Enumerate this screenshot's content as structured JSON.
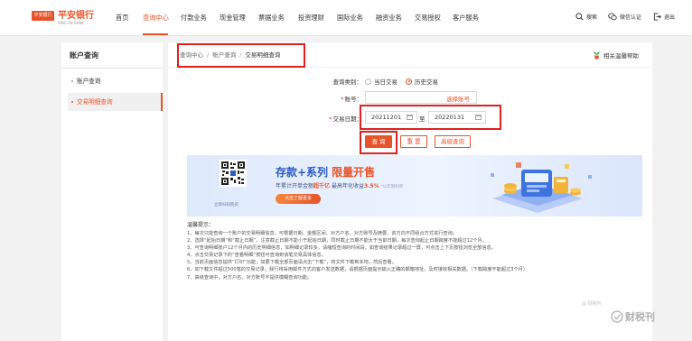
{
  "brand": {
    "badge": "平安银行",
    "name": "平安银行",
    "sub": "PING AN BANK"
  },
  "nav": [
    {
      "label": "首页"
    },
    {
      "label": "查询中心"
    },
    {
      "label": "付款业务"
    },
    {
      "label": "现金管理"
    },
    {
      "label": "票据业务"
    },
    {
      "label": "投资理财"
    },
    {
      "label": "国际业务"
    },
    {
      "label": "融资业务"
    },
    {
      "label": "交易授权"
    },
    {
      "label": "客户服务"
    }
  ],
  "tools": {
    "search": "搜索",
    "wechat": "微信认证",
    "logout": "退出"
  },
  "sidebar": {
    "title": "账户查询",
    "items": [
      {
        "label": "账户查询"
      },
      {
        "label": "交易明细查询"
      }
    ]
  },
  "breadcrumb": {
    "items": [
      "查询中心",
      "账户查询",
      "交易明细查询"
    ]
  },
  "help": {
    "label": "相关温馨帮助"
  },
  "form": {
    "query_type_label": "查询类别：",
    "radio_today": "当日交易",
    "radio_history": "历史交易",
    "selected": "历史交易",
    "account_label": "账号：",
    "account_value": "",
    "select_account": "选择账号",
    "date_label": "交易日期：",
    "date_from": "20211201",
    "date_to_sep": "至",
    "date_to": "20220131",
    "query_button": "查 询",
    "reset_button": "重 置",
    "advanced_button": "高级查询"
  },
  "banner": {
    "title_main": "存款+系列",
    "title_highlight": "限量开售",
    "subtitle_prefix": "年累计开单金额",
    "subtitle_amount": "超千亿",
    "subtitle_mid": "最高年化收益",
    "subtitle_rate": "3.5%",
    "subtitle_note": "*以年期利率",
    "button": "点击了解更多",
    "qr_caption": "立即扫码购买"
  },
  "tips": {
    "title": "温馨提示：",
    "items": [
      "1、每次只能查询一个账户的交易明细信息，可根据日期、金额区间、对方户名、对方账号及摘要、资方向不同组合方式进行查询。",
      "2、选择“起始日期”和“截止日期”，注意截止日期不能小于起始日期，同时截止日期不能大于当前日期，每次查询起止日期跨度不能超过12个月。",
      "3、可查询明细账户12个月内的历史明细信息，如明细记录较多，请缩短查询的时间段，如查询结果记录超过一屏，可点击上下页按钮浏览全部信息。",
      "4、点击交易记录下的“查看明细”按钮可查询到该笔交易具体信息。",
      "5、当前页面信息提供“打印”功能；如要下载全部页面请点击“下载”，将文件下载到本地，然后查看。",
      "6、如下载文件超过500笔的交易记录，我行将采用邮件方式向客户发送数据，请根据页面提示输入正确的邮箱地址，及时接收相关数据。（下载跨度不能超过3个月）",
      "7、高级查询中，对方户名、对方账号不提供模糊查询功能。"
    ]
  },
  "watermark": {
    "text": "财税刊",
    "small": "@ 财税刊"
  },
  "colors": {
    "accent": "#e8542a",
    "highlight_box": "#e02020",
    "banner_blue": "#2c5cc5"
  }
}
